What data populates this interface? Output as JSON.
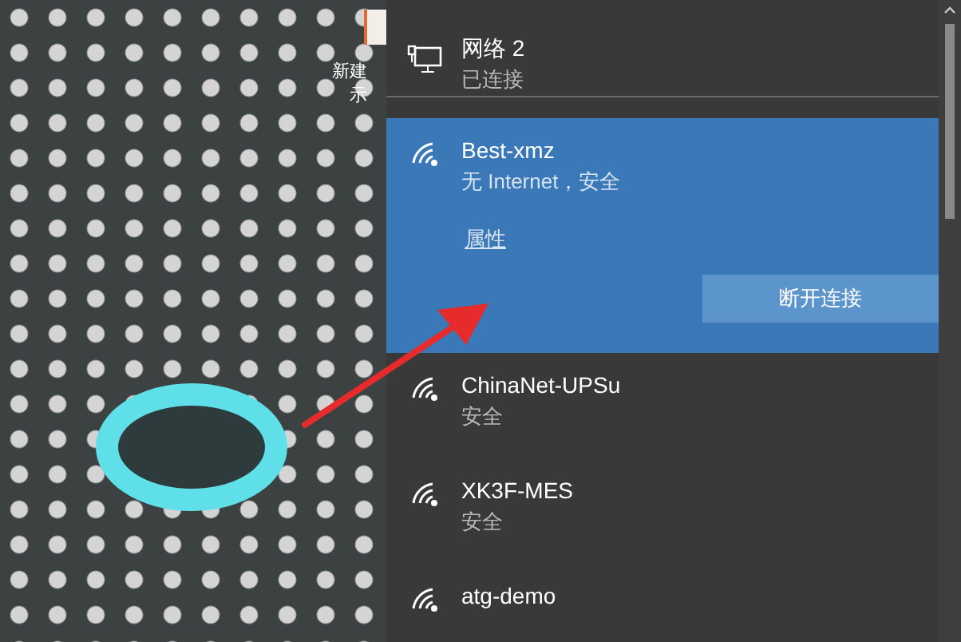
{
  "desktop": {
    "icon_label_lines": [
      "新建",
      "示"
    ]
  },
  "wired": {
    "name": "网络 2",
    "status": "已连接"
  },
  "networks": [
    {
      "name": "Best-xmz",
      "status": "无 Internet，安全",
      "selected": true,
      "properties_link": "属性",
      "disconnect_button": "断开连接"
    },
    {
      "name": "ChinaNet-UPSu",
      "status": "安全",
      "selected": false
    },
    {
      "name": "XK3F-MES",
      "status": "安全",
      "selected": false
    },
    {
      "name": "atg-demo",
      "selected": false
    }
  ]
}
